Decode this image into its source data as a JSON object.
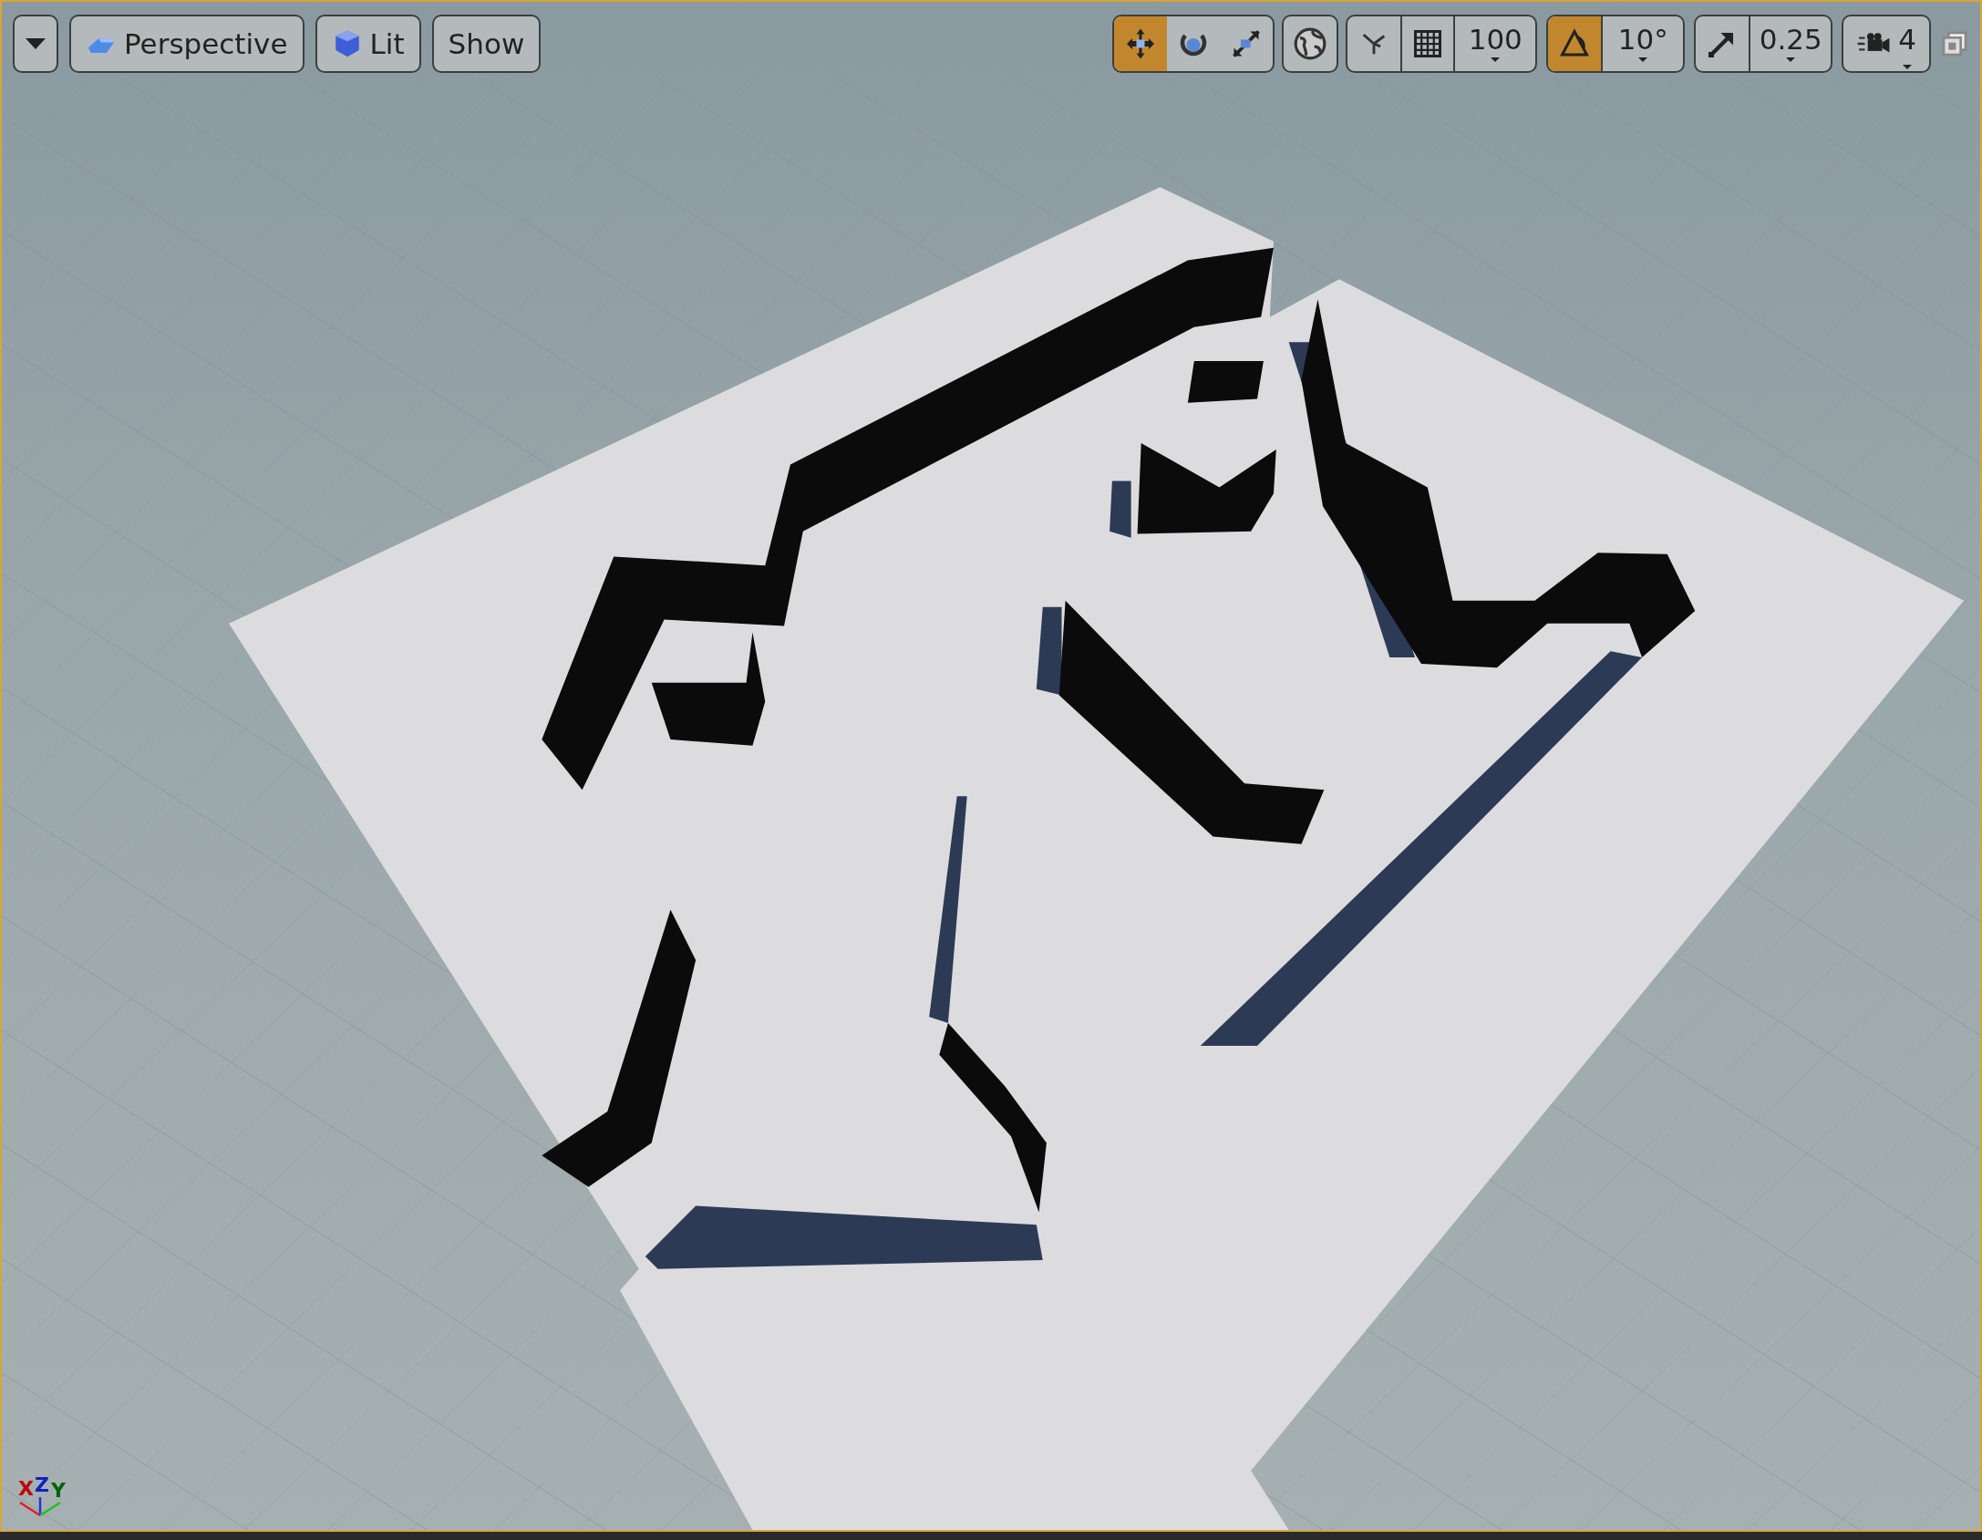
{
  "viewport_toolbar": {
    "left_buttons": [
      {
        "kind": "menu"
      },
      {
        "kind": "perspective",
        "label": "Perspective"
      },
      {
        "kind": "lit",
        "label": "Lit"
      },
      {
        "kind": "plain",
        "label": "Show"
      }
    ],
    "transform_tools": [
      {
        "kind": "translate",
        "selected": true
      },
      {
        "kind": "rotate",
        "selected": false
      },
      {
        "kind": "scale",
        "selected": false
      }
    ],
    "grid_snap": {
      "on": false,
      "value": "100"
    },
    "rotation_snap": {
      "on": true,
      "value": "10°"
    },
    "scale_snap": {
      "on": false,
      "value": "0.25"
    },
    "camera_speed": {
      "value": "4"
    }
  },
  "axis_gizmo": {
    "labels": [
      "X",
      "Z",
      "Y"
    ]
  }
}
